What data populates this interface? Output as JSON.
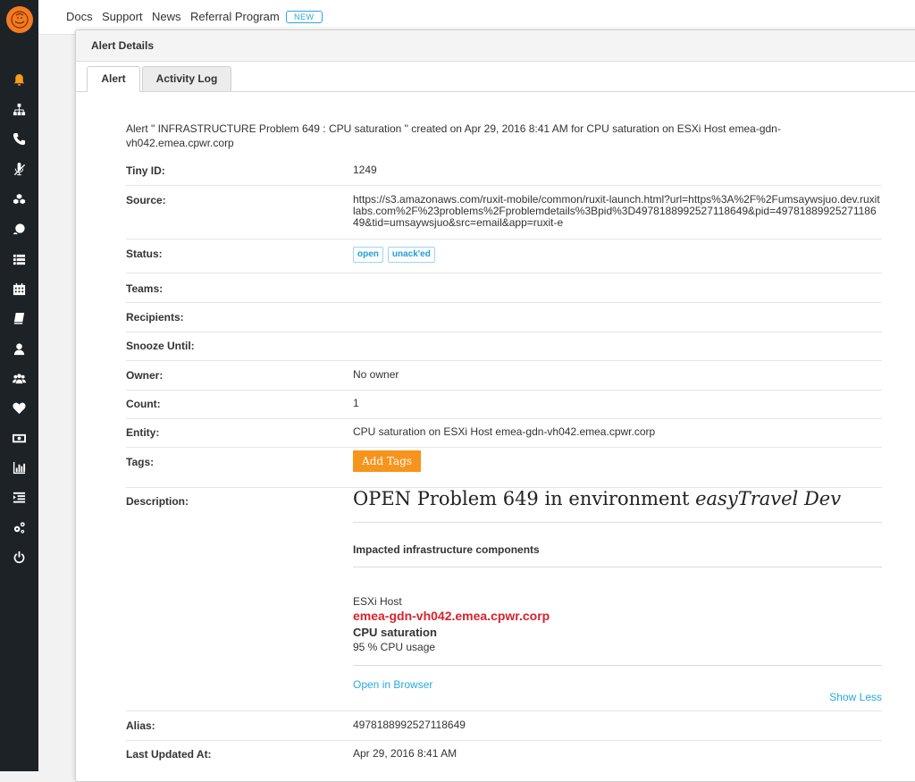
{
  "topnav": {
    "links": [
      "Docs",
      "Support",
      "News",
      "Referral Program"
    ],
    "badge": "NEW"
  },
  "sidebar": {
    "icons": [
      "bell-icon",
      "sitemap-icon",
      "phone-icon",
      "mute-icon",
      "cubes-icon",
      "heads-icon",
      "list-icon",
      "calendar-icon",
      "book-icon",
      "user-icon",
      "users-icon",
      "heart-icon",
      "money-icon",
      "bar-chart-icon",
      "indent-icon",
      "cogs-icon",
      "power-icon"
    ]
  },
  "panel": {
    "title": "Alert Details",
    "tabs": [
      "Alert",
      "Activity Log"
    ]
  },
  "alert": {
    "intro": "Alert \" INFRASTRUCTURE Problem 649 : CPU saturation \" created on Apr 29, 2016 8:41 AM for CPU saturation on ESXi Host emea-gdn-vh042.emea.cpwr.corp",
    "tiny_id_label": "Tiny ID:",
    "tiny_id": "1249",
    "source_label": "Source:",
    "source": "https://s3.amazonaws.com/ruxit-mobile/common/ruxit-launch.html?url=https%3A%2F%2Fumsaywsjuo.dev.ruxitlabs.com%2F%23problems%2Fproblemdetails%3Bpid%3D4978188992527118649&pid=4978188992527118649&tid=umsaywsjuo&src=email&app=ruxit-e",
    "status_label": "Status:",
    "status_tags": [
      "open",
      "unack'ed"
    ],
    "teams_label": "Teams:",
    "recipients_label": "Recipients:",
    "snooze_label": "Snooze Until:",
    "owner_label": "Owner:",
    "owner": "No owner",
    "count_label": "Count:",
    "count": "1",
    "entity_label": "Entity:",
    "entity": "CPU saturation on ESXi Host emea-gdn-vh042.emea.cpwr.corp",
    "tags_label": "Tags:",
    "add_tags": "Add Tags",
    "description_label": "Description:",
    "description": {
      "title_prefix": "OPEN Problem 649 in environment ",
      "title_env": "easyTravel Dev",
      "subtitle": "Impacted infrastructure components",
      "host_type": "ESXi Host",
      "host_name": "emea-gdn-vh042.emea.cpwr.corp",
      "problem": "CPU saturation",
      "metric": "95 % CPU usage",
      "open_link": "Open in Browser",
      "show_less": "Show Less"
    },
    "alias_label": "Alias:",
    "alias": "4978188992527118649",
    "updated_label": "Last Updated At:",
    "updated": "Apr 29, 2016 8:41 AM"
  },
  "colors": {
    "accent": "#f7941d",
    "link": "#28a8e0",
    "host_red": "#d9232d",
    "sidebar_bg": "#1d2227"
  }
}
